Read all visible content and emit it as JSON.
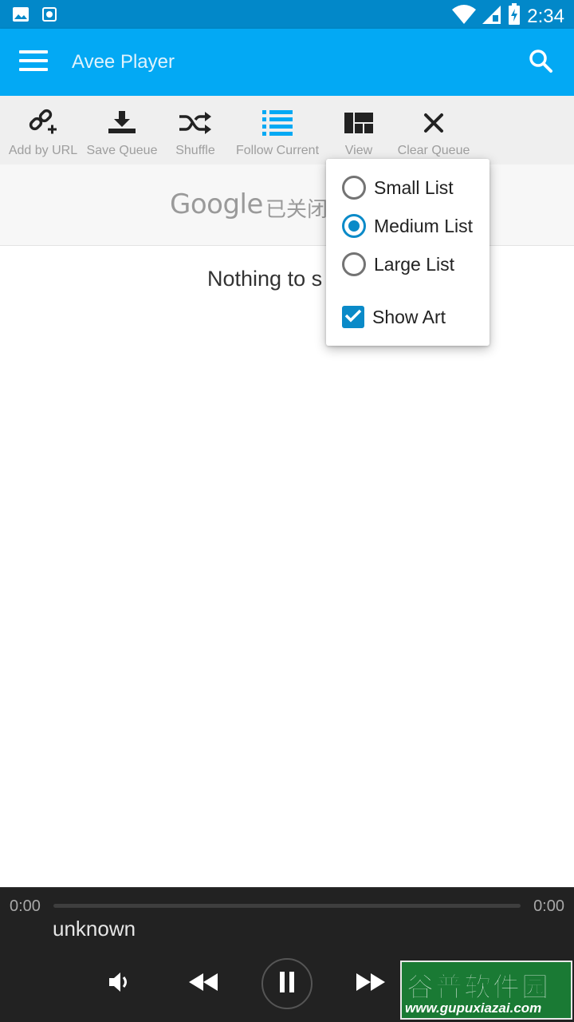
{
  "status_bar": {
    "time": "2:34",
    "icons": [
      "image-notification-icon",
      "screen-record-icon",
      "wifi-icon",
      "cell-signal-icon",
      "battery-charging-icon"
    ]
  },
  "app_bar": {
    "title": "Avee Player",
    "menu_icon": "hamburger-menu-icon",
    "search_icon": "search-icon",
    "color": "#03a9f4"
  },
  "toolbar": {
    "items": [
      {
        "label": "Add by URL",
        "icon": "add-link-icon"
      },
      {
        "label": "Save Queue",
        "icon": "download-icon"
      },
      {
        "label": "Shuffle",
        "icon": "shuffle-icon"
      },
      {
        "label": "Follow Current",
        "icon": "list-icon"
      },
      {
        "label": "View",
        "icon": "view-layout-icon"
      },
      {
        "label": "Clear Queue",
        "icon": "close-icon"
      }
    ],
    "accent": "#03a9f4"
  },
  "ad": {
    "logo": "Google",
    "text": "已关闭"
  },
  "main": {
    "empty_text": "Nothing to s"
  },
  "view_menu": {
    "options": [
      {
        "label": "Small List",
        "selected": false
      },
      {
        "label": "Medium List",
        "selected": true
      },
      {
        "label": "Large List",
        "selected": false
      }
    ],
    "show_art": {
      "label": "Show Art",
      "checked": true
    },
    "accent": "#0a8ac8"
  },
  "player": {
    "time_elapsed": "0:00",
    "time_total": "0:00",
    "progress": 0,
    "track": "unknown",
    "controls": [
      "volume-icon",
      "rewind-icon",
      "pause-icon",
      "fast-forward-icon"
    ]
  },
  "watermark": {
    "title": "谷普软件园",
    "url": "www.gupuxiazai.com"
  }
}
